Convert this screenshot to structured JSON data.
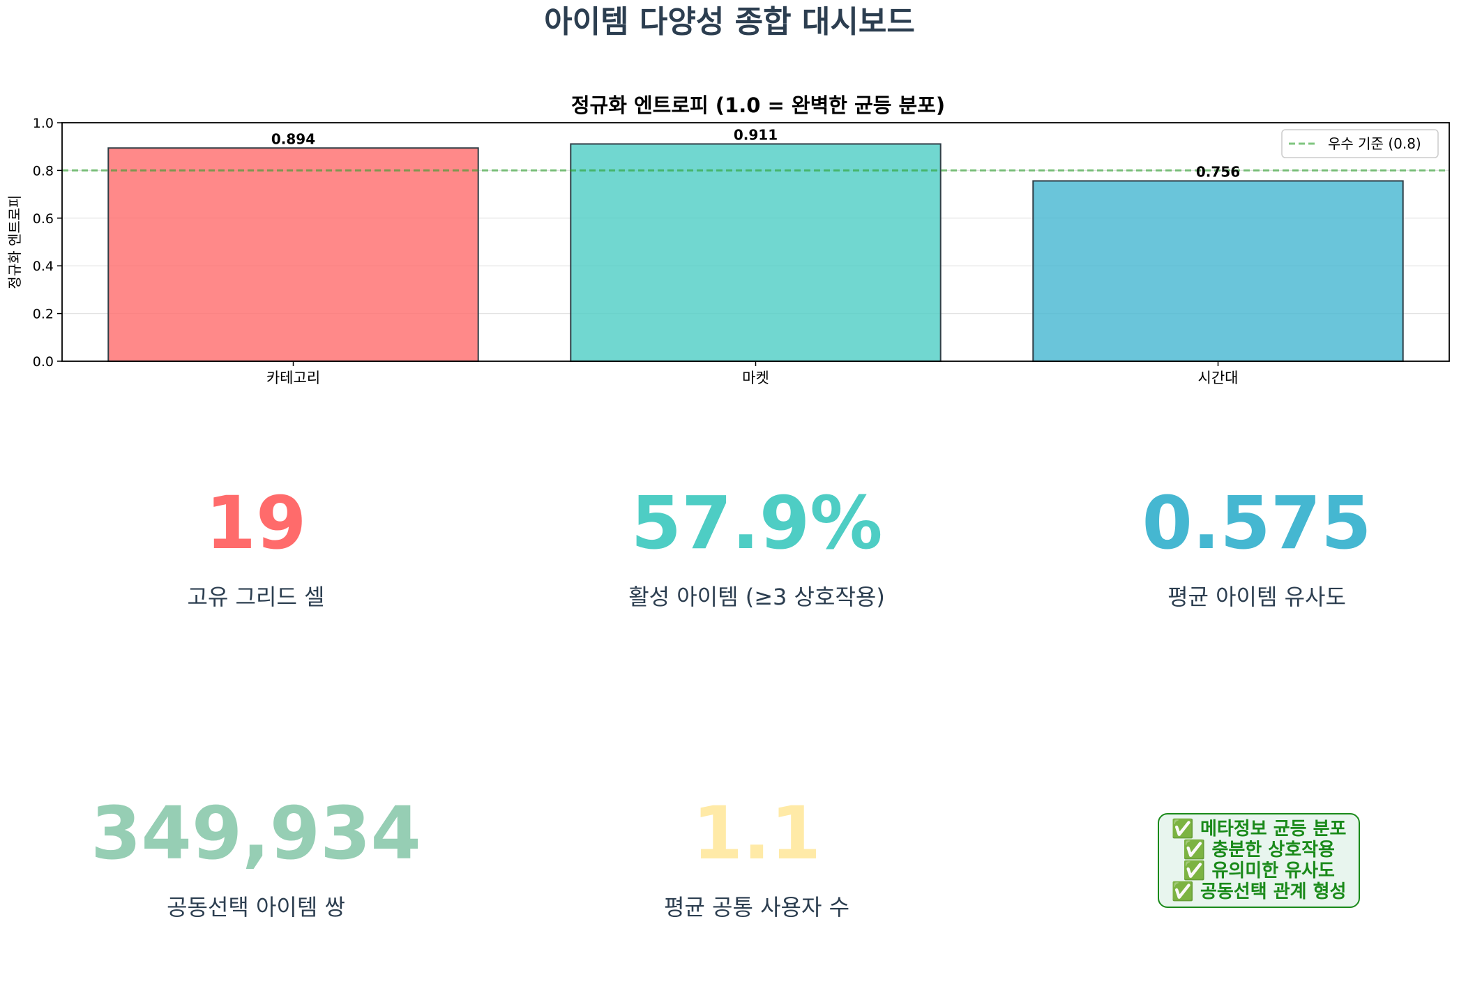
{
  "dashboard": {
    "title": "아이템 다양성 종합 대시보드"
  },
  "chart_data": {
    "type": "bar",
    "title": "정규화 엔트로피 (1.0 = 완벽한 균등 분포)",
    "xlabel": "",
    "ylabel": "정규화 엔트로피",
    "categories": [
      "카테고리",
      "마켓",
      "시간대"
    ],
    "values": [
      0.894,
      0.911,
      0.756
    ],
    "value_labels": [
      "0.894",
      "0.911",
      "0.756"
    ],
    "bar_colors": [
      "#ff6b6b",
      "#4ecdc4",
      "#45b7d1"
    ],
    "ylim": [
      0,
      1.0
    ],
    "yticks": [
      "0.0",
      "0.2",
      "0.4",
      "0.6",
      "0.8",
      "1.0"
    ],
    "reference_line": {
      "value": 0.8,
      "label": "우수 기준 (0.8)",
      "color": "#2ca02c"
    },
    "grid": true,
    "legend_position": "top-right"
  },
  "metrics": [
    {
      "value": "19",
      "label": "고유 그리드 셀",
      "color": "#ff6b6b"
    },
    {
      "value": "57.9%",
      "label": "활성 아이템 (≥3 상호작용)",
      "color": "#4ecdc4"
    },
    {
      "value": "0.575",
      "label": "평균 아이템 유사도",
      "color": "#45b7d1"
    },
    {
      "value": "349,934",
      "label": "공동선택 아이템 쌍",
      "color": "#96ceb4"
    },
    {
      "value": "1.1",
      "label": "평균 공통 사용자 수",
      "color": "#ffeaa7"
    }
  ],
  "status": {
    "lines": [
      "✅ 메타정보 균등 분포",
      "✅ 충분한 상호작용",
      "✅ 유의미한 유사도",
      "✅ 공동선택 관계 형성"
    ],
    "color": "#1a8a1a"
  }
}
